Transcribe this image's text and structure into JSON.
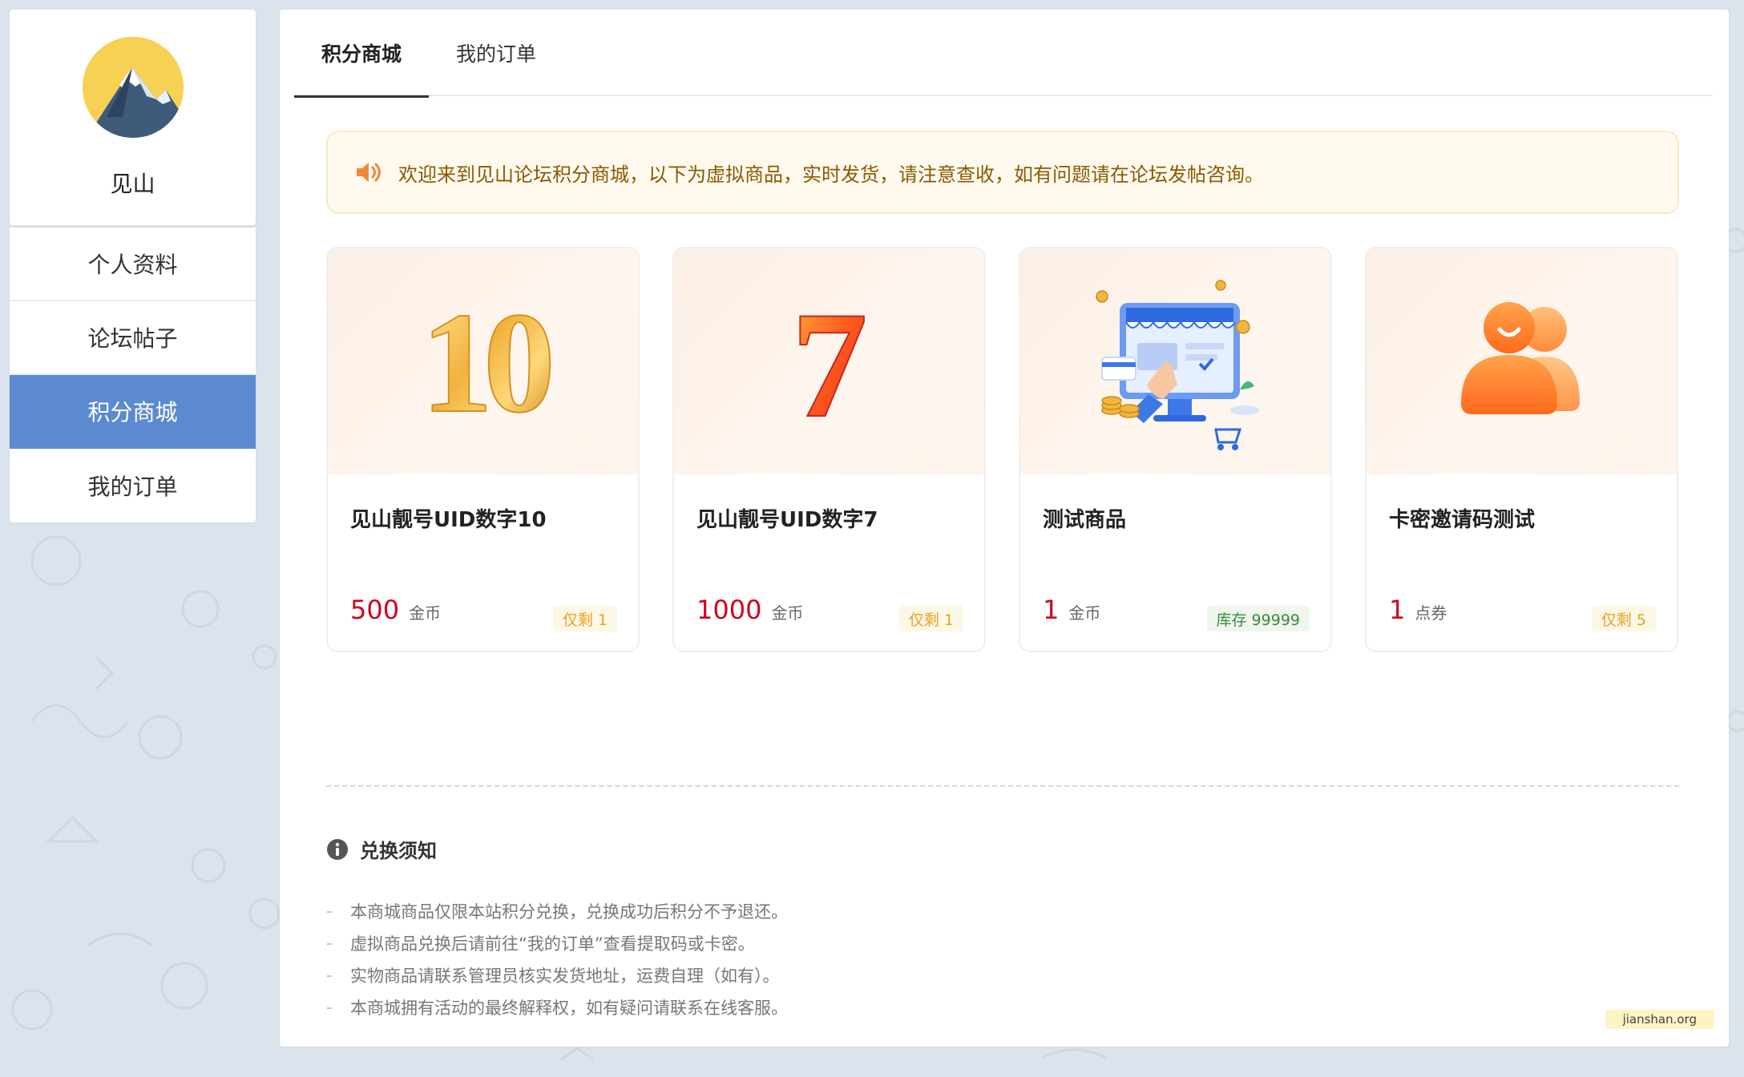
{
  "profile": {
    "username": "见山"
  },
  "sidebar": {
    "items": [
      {
        "label": "个人资料",
        "active": false
      },
      {
        "label": "论坛帖子",
        "active": false
      },
      {
        "label": "积分商城",
        "active": true
      },
      {
        "label": "我的订单",
        "active": false
      }
    ]
  },
  "tabs": [
    {
      "label": "积分商城",
      "active": true
    },
    {
      "label": "我的订单",
      "active": false
    }
  ],
  "notice": {
    "text": "欢迎来到见山论坛积分商城，以下为虚拟商品，实时发货，请注意查收，如有问题请在论坛发帖咨询。",
    "icon": "speaker-icon"
  },
  "products": [
    {
      "title": "见山靓号UID数字10",
      "price": "500",
      "unit": "金币",
      "stock": "仅剩 1",
      "stock_type": "left",
      "image": "number-10-image"
    },
    {
      "title": "见山靓号UID数字7",
      "price": "1000",
      "unit": "金币",
      "stock": "仅剩 1",
      "stock_type": "left",
      "image": "number-7-image"
    },
    {
      "title": "测试商品",
      "price": "1",
      "unit": "金币",
      "stock": "库存 99999",
      "stock_type": "inventory",
      "image": "online-shop-image"
    },
    {
      "title": "卡密邀请码测试",
      "price": "1",
      "unit": "点券",
      "stock": "仅剩 5",
      "stock_type": "left",
      "image": "users-image"
    }
  ],
  "rules": {
    "heading": "兑换须知",
    "items": [
      "本商城商品仅限本站积分兑换，兑换成功后积分不予退还。",
      "虚拟商品兑换后请前往“我的订单”查看提取码或卡密。",
      "实物商品请联系管理员核实发货地址，运费自理（如有）。",
      "本商城拥有活动的最终解释权，如有疑问请联系在线客服。"
    ],
    "bullet": "-"
  },
  "watermark": "jianshan.org",
  "colors": {
    "accent": "#5b8ad1",
    "price": "#d0021b",
    "notice_bg": "#fff9ee",
    "notice_text": "#8a5a00",
    "stock_left": "#e7a224",
    "stock_inventory": "#3a8a3a"
  }
}
